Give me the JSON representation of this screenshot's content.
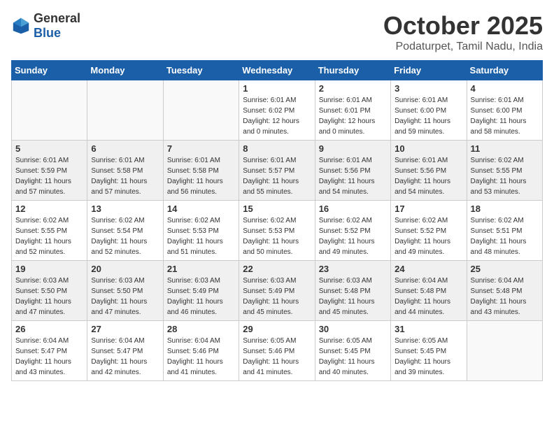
{
  "header": {
    "logo_general": "General",
    "logo_blue": "Blue",
    "month_title": "October 2025",
    "location": "Podaturpet, Tamil Nadu, India"
  },
  "weekdays": [
    "Sunday",
    "Monday",
    "Tuesday",
    "Wednesday",
    "Thursday",
    "Friday",
    "Saturday"
  ],
  "weeks": [
    [
      {
        "day": "",
        "sunrise": "",
        "sunset": "",
        "daylight": ""
      },
      {
        "day": "",
        "sunrise": "",
        "sunset": "",
        "daylight": ""
      },
      {
        "day": "",
        "sunrise": "",
        "sunset": "",
        "daylight": ""
      },
      {
        "day": "1",
        "sunrise": "Sunrise: 6:01 AM",
        "sunset": "Sunset: 6:02 PM",
        "daylight": "Daylight: 12 hours and 0 minutes."
      },
      {
        "day": "2",
        "sunrise": "Sunrise: 6:01 AM",
        "sunset": "Sunset: 6:01 PM",
        "daylight": "Daylight: 12 hours and 0 minutes."
      },
      {
        "day": "3",
        "sunrise": "Sunrise: 6:01 AM",
        "sunset": "Sunset: 6:00 PM",
        "daylight": "Daylight: 11 hours and 59 minutes."
      },
      {
        "day": "4",
        "sunrise": "Sunrise: 6:01 AM",
        "sunset": "Sunset: 6:00 PM",
        "daylight": "Daylight: 11 hours and 58 minutes."
      }
    ],
    [
      {
        "day": "5",
        "sunrise": "Sunrise: 6:01 AM",
        "sunset": "Sunset: 5:59 PM",
        "daylight": "Daylight: 11 hours and 57 minutes."
      },
      {
        "day": "6",
        "sunrise": "Sunrise: 6:01 AM",
        "sunset": "Sunset: 5:58 PM",
        "daylight": "Daylight: 11 hours and 57 minutes."
      },
      {
        "day": "7",
        "sunrise": "Sunrise: 6:01 AM",
        "sunset": "Sunset: 5:58 PM",
        "daylight": "Daylight: 11 hours and 56 minutes."
      },
      {
        "day": "8",
        "sunrise": "Sunrise: 6:01 AM",
        "sunset": "Sunset: 5:57 PM",
        "daylight": "Daylight: 11 hours and 55 minutes."
      },
      {
        "day": "9",
        "sunrise": "Sunrise: 6:01 AM",
        "sunset": "Sunset: 5:56 PM",
        "daylight": "Daylight: 11 hours and 54 minutes."
      },
      {
        "day": "10",
        "sunrise": "Sunrise: 6:01 AM",
        "sunset": "Sunset: 5:56 PM",
        "daylight": "Daylight: 11 hours and 54 minutes."
      },
      {
        "day": "11",
        "sunrise": "Sunrise: 6:02 AM",
        "sunset": "Sunset: 5:55 PM",
        "daylight": "Daylight: 11 hours and 53 minutes."
      }
    ],
    [
      {
        "day": "12",
        "sunrise": "Sunrise: 6:02 AM",
        "sunset": "Sunset: 5:55 PM",
        "daylight": "Daylight: 11 hours and 52 minutes."
      },
      {
        "day": "13",
        "sunrise": "Sunrise: 6:02 AM",
        "sunset": "Sunset: 5:54 PM",
        "daylight": "Daylight: 11 hours and 52 minutes."
      },
      {
        "day": "14",
        "sunrise": "Sunrise: 6:02 AM",
        "sunset": "Sunset: 5:53 PM",
        "daylight": "Daylight: 11 hours and 51 minutes."
      },
      {
        "day": "15",
        "sunrise": "Sunrise: 6:02 AM",
        "sunset": "Sunset: 5:53 PM",
        "daylight": "Daylight: 11 hours and 50 minutes."
      },
      {
        "day": "16",
        "sunrise": "Sunrise: 6:02 AM",
        "sunset": "Sunset: 5:52 PM",
        "daylight": "Daylight: 11 hours and 49 minutes."
      },
      {
        "day": "17",
        "sunrise": "Sunrise: 6:02 AM",
        "sunset": "Sunset: 5:52 PM",
        "daylight": "Daylight: 11 hours and 49 minutes."
      },
      {
        "day": "18",
        "sunrise": "Sunrise: 6:02 AM",
        "sunset": "Sunset: 5:51 PM",
        "daylight": "Daylight: 11 hours and 48 minutes."
      }
    ],
    [
      {
        "day": "19",
        "sunrise": "Sunrise: 6:03 AM",
        "sunset": "Sunset: 5:50 PM",
        "daylight": "Daylight: 11 hours and 47 minutes."
      },
      {
        "day": "20",
        "sunrise": "Sunrise: 6:03 AM",
        "sunset": "Sunset: 5:50 PM",
        "daylight": "Daylight: 11 hours and 47 minutes."
      },
      {
        "day": "21",
        "sunrise": "Sunrise: 6:03 AM",
        "sunset": "Sunset: 5:49 PM",
        "daylight": "Daylight: 11 hours and 46 minutes."
      },
      {
        "day": "22",
        "sunrise": "Sunrise: 6:03 AM",
        "sunset": "Sunset: 5:49 PM",
        "daylight": "Daylight: 11 hours and 45 minutes."
      },
      {
        "day": "23",
        "sunrise": "Sunrise: 6:03 AM",
        "sunset": "Sunset: 5:48 PM",
        "daylight": "Daylight: 11 hours and 45 minutes."
      },
      {
        "day": "24",
        "sunrise": "Sunrise: 6:04 AM",
        "sunset": "Sunset: 5:48 PM",
        "daylight": "Daylight: 11 hours and 44 minutes."
      },
      {
        "day": "25",
        "sunrise": "Sunrise: 6:04 AM",
        "sunset": "Sunset: 5:48 PM",
        "daylight": "Daylight: 11 hours and 43 minutes."
      }
    ],
    [
      {
        "day": "26",
        "sunrise": "Sunrise: 6:04 AM",
        "sunset": "Sunset: 5:47 PM",
        "daylight": "Daylight: 11 hours and 43 minutes."
      },
      {
        "day": "27",
        "sunrise": "Sunrise: 6:04 AM",
        "sunset": "Sunset: 5:47 PM",
        "daylight": "Daylight: 11 hours and 42 minutes."
      },
      {
        "day": "28",
        "sunrise": "Sunrise: 6:04 AM",
        "sunset": "Sunset: 5:46 PM",
        "daylight": "Daylight: 11 hours and 41 minutes."
      },
      {
        "day": "29",
        "sunrise": "Sunrise: 6:05 AM",
        "sunset": "Sunset: 5:46 PM",
        "daylight": "Daylight: 11 hours and 41 minutes."
      },
      {
        "day": "30",
        "sunrise": "Sunrise: 6:05 AM",
        "sunset": "Sunset: 5:45 PM",
        "daylight": "Daylight: 11 hours and 40 minutes."
      },
      {
        "day": "31",
        "sunrise": "Sunrise: 6:05 AM",
        "sunset": "Sunset: 5:45 PM",
        "daylight": "Daylight: 11 hours and 39 minutes."
      },
      {
        "day": "",
        "sunrise": "",
        "sunset": "",
        "daylight": ""
      }
    ]
  ]
}
